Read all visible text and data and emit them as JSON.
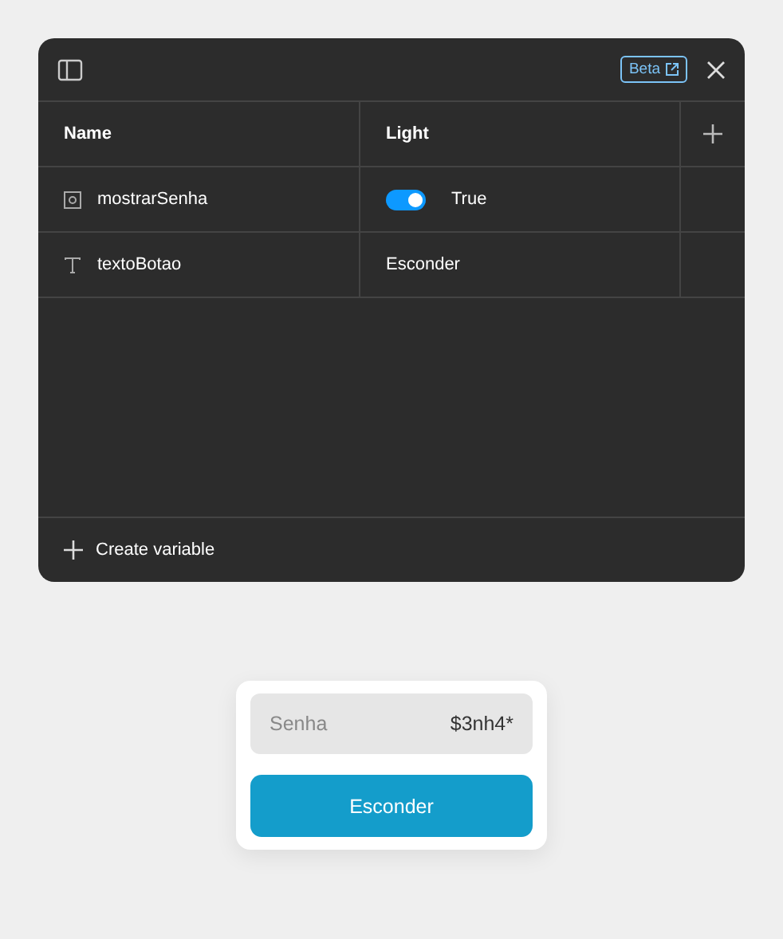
{
  "panel": {
    "beta_label": "Beta",
    "columns": [
      "Name",
      "Light"
    ],
    "variables": [
      {
        "kind": "boolean",
        "name": "mostrarSenha",
        "on": true,
        "value_text": "True"
      },
      {
        "kind": "string",
        "name": "textoBotao",
        "value_text": "Esconder"
      }
    ],
    "create_label": "Create variable"
  },
  "preview": {
    "field": {
      "label": "Senha",
      "value": "$3nh4*"
    },
    "button": "Esconder"
  }
}
